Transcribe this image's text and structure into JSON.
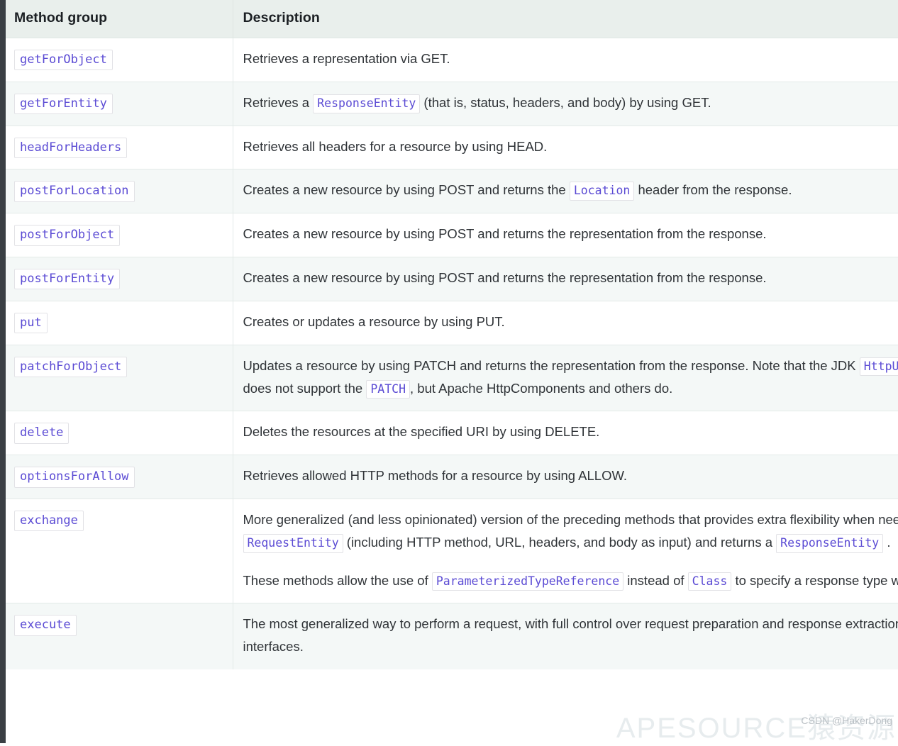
{
  "table": {
    "headers": {
      "method_group": "Method group",
      "description": "Description"
    },
    "rows": [
      {
        "method": "getForObject",
        "paragraphs": [
          [
            {
              "t": "text",
              "v": "Retrieves a representation via GET."
            }
          ]
        ]
      },
      {
        "method": "getForEntity",
        "paragraphs": [
          [
            {
              "t": "text",
              "v": "Retrieves a "
            },
            {
              "t": "code",
              "v": "ResponseEntity"
            },
            {
              "t": "text",
              "v": " (that is, status, headers, and body) by using GET."
            }
          ]
        ]
      },
      {
        "method": "headForHeaders",
        "paragraphs": [
          [
            {
              "t": "text",
              "v": "Retrieves all headers for a resource by using HEAD."
            }
          ]
        ]
      },
      {
        "method": "postForLocation",
        "paragraphs": [
          [
            {
              "t": "text",
              "v": "Creates a new resource by using POST and returns the "
            },
            {
              "t": "code",
              "v": "Location"
            },
            {
              "t": "text",
              "v": " header from the response."
            }
          ]
        ]
      },
      {
        "method": "postForObject",
        "paragraphs": [
          [
            {
              "t": "text",
              "v": "Creates a new resource by using POST and returns the representation from the response."
            }
          ]
        ]
      },
      {
        "method": "postForEntity",
        "paragraphs": [
          [
            {
              "t": "text",
              "v": "Creates a new resource by using POST and returns the representation from the response."
            }
          ]
        ]
      },
      {
        "method": "put",
        "paragraphs": [
          [
            {
              "t": "text",
              "v": "Creates or updates a resource by using PUT."
            }
          ]
        ]
      },
      {
        "method": "patchForObject",
        "paragraphs": [
          [
            {
              "t": "text",
              "v": "Updates a resource by using PATCH and returns the representation from the response. Note that the JDK "
            },
            {
              "t": "code",
              "v": "HttpURLConnection"
            },
            {
              "t": "text",
              "v": " does not support the "
            },
            {
              "t": "code",
              "v": "PATCH"
            },
            {
              "t": "text",
              "v": ", but Apache HttpComponents and others do."
            }
          ]
        ]
      },
      {
        "method": "delete",
        "paragraphs": [
          [
            {
              "t": "text",
              "v": "Deletes the resources at the specified URI by using DELETE."
            }
          ]
        ]
      },
      {
        "method": "optionsForAllow",
        "paragraphs": [
          [
            {
              "t": "text",
              "v": "Retrieves allowed HTTP methods for a resource by using ALLOW."
            }
          ]
        ]
      },
      {
        "method": "exchange",
        "paragraphs": [
          [
            {
              "t": "text",
              "v": "More generalized (and less opinionated) version of the preceding methods that provides extra flexibility when needed. It accepts a "
            },
            {
              "t": "code",
              "v": "RequestEntity"
            },
            {
              "t": "text",
              "v": " (including HTTP method, URL, headers, and body as input) and returns a "
            },
            {
              "t": "code",
              "v": "ResponseEntity"
            },
            {
              "t": "text",
              "v": " ."
            }
          ],
          [
            {
              "t": "text",
              "v": "These methods allow the use of "
            },
            {
              "t": "code",
              "v": "ParameterizedTypeReference"
            },
            {
              "t": "text",
              "v": " instead of "
            },
            {
              "t": "code",
              "v": "Class"
            },
            {
              "t": "text",
              "v": " to specify a response type with generics."
            }
          ]
        ]
      },
      {
        "method": "execute",
        "paragraphs": [
          [
            {
              "t": "text",
              "v": "The most generalized way to perform a request, with full control over request preparation and response extraction through callback interfaces."
            }
          ]
        ]
      }
    ]
  },
  "watermarks": {
    "brand": "APESOURCE猿资源",
    "user": "CSDN @HakerDong"
  },
  "colors": {
    "code_text": "#5b4bd4",
    "header_bg": "#e9efec",
    "row_alt_bg": "#f4f8f7",
    "body_text": "#2f3337",
    "gutter": "#3a3f44"
  }
}
